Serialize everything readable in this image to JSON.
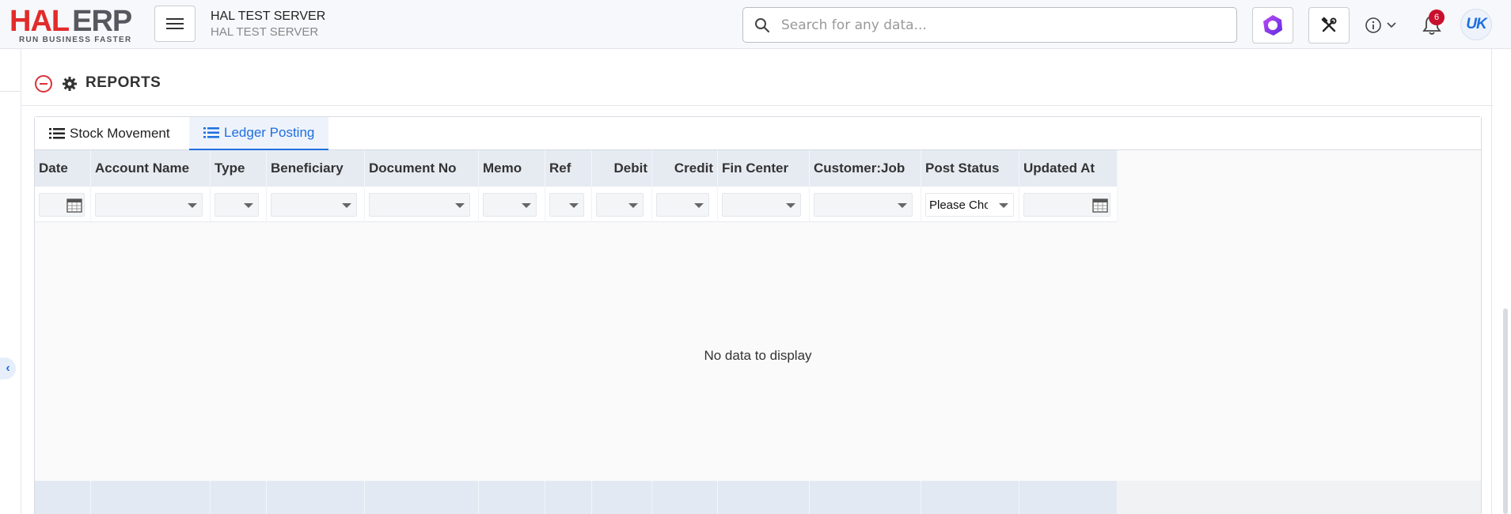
{
  "app": {
    "logo_main": "HAL",
    "logo_accent": "ERP",
    "logo_tagline": "RUN BUSINESS FASTER",
    "server_title": "HAL TEST SERVER",
    "server_subtitle": "HAL TEST SERVER"
  },
  "search": {
    "placeholder": "Search for any data..."
  },
  "topbar": {
    "notification_count": "6",
    "avatar_initials": "UK",
    "brand_color": "#e22b2b",
    "accent_color": "#1f6fe0"
  },
  "section": {
    "title": "REPORTS"
  },
  "tabs": [
    {
      "label": "Stock Movement",
      "icon": "list-icon",
      "active": false
    },
    {
      "label": "Ledger Posting",
      "icon": "list-icon",
      "active": true
    }
  ],
  "grid": {
    "columns": [
      {
        "label": "Date",
        "filter": "date"
      },
      {
        "label": "Account Name",
        "filter": "dropdown"
      },
      {
        "label": "Type",
        "filter": "dropdown"
      },
      {
        "label": "Beneficiary",
        "filter": "dropdown"
      },
      {
        "label": "Document No",
        "filter": "dropdown"
      },
      {
        "label": "Memo",
        "filter": "dropdown"
      },
      {
        "label": "Ref",
        "filter": "dropdown"
      },
      {
        "label": "Debit",
        "filter": "dropdown"
      },
      {
        "label": "Credit",
        "filter": "dropdown"
      },
      {
        "label": "Fin Center",
        "filter": "dropdown"
      },
      {
        "label": "Customer:Job",
        "filter": "dropdown"
      },
      {
        "label": "Post Status",
        "filter": "dropdown",
        "value": "Please Choose"
      },
      {
        "label": "Updated At",
        "filter": "date"
      }
    ],
    "empty_text": "No data to display"
  }
}
